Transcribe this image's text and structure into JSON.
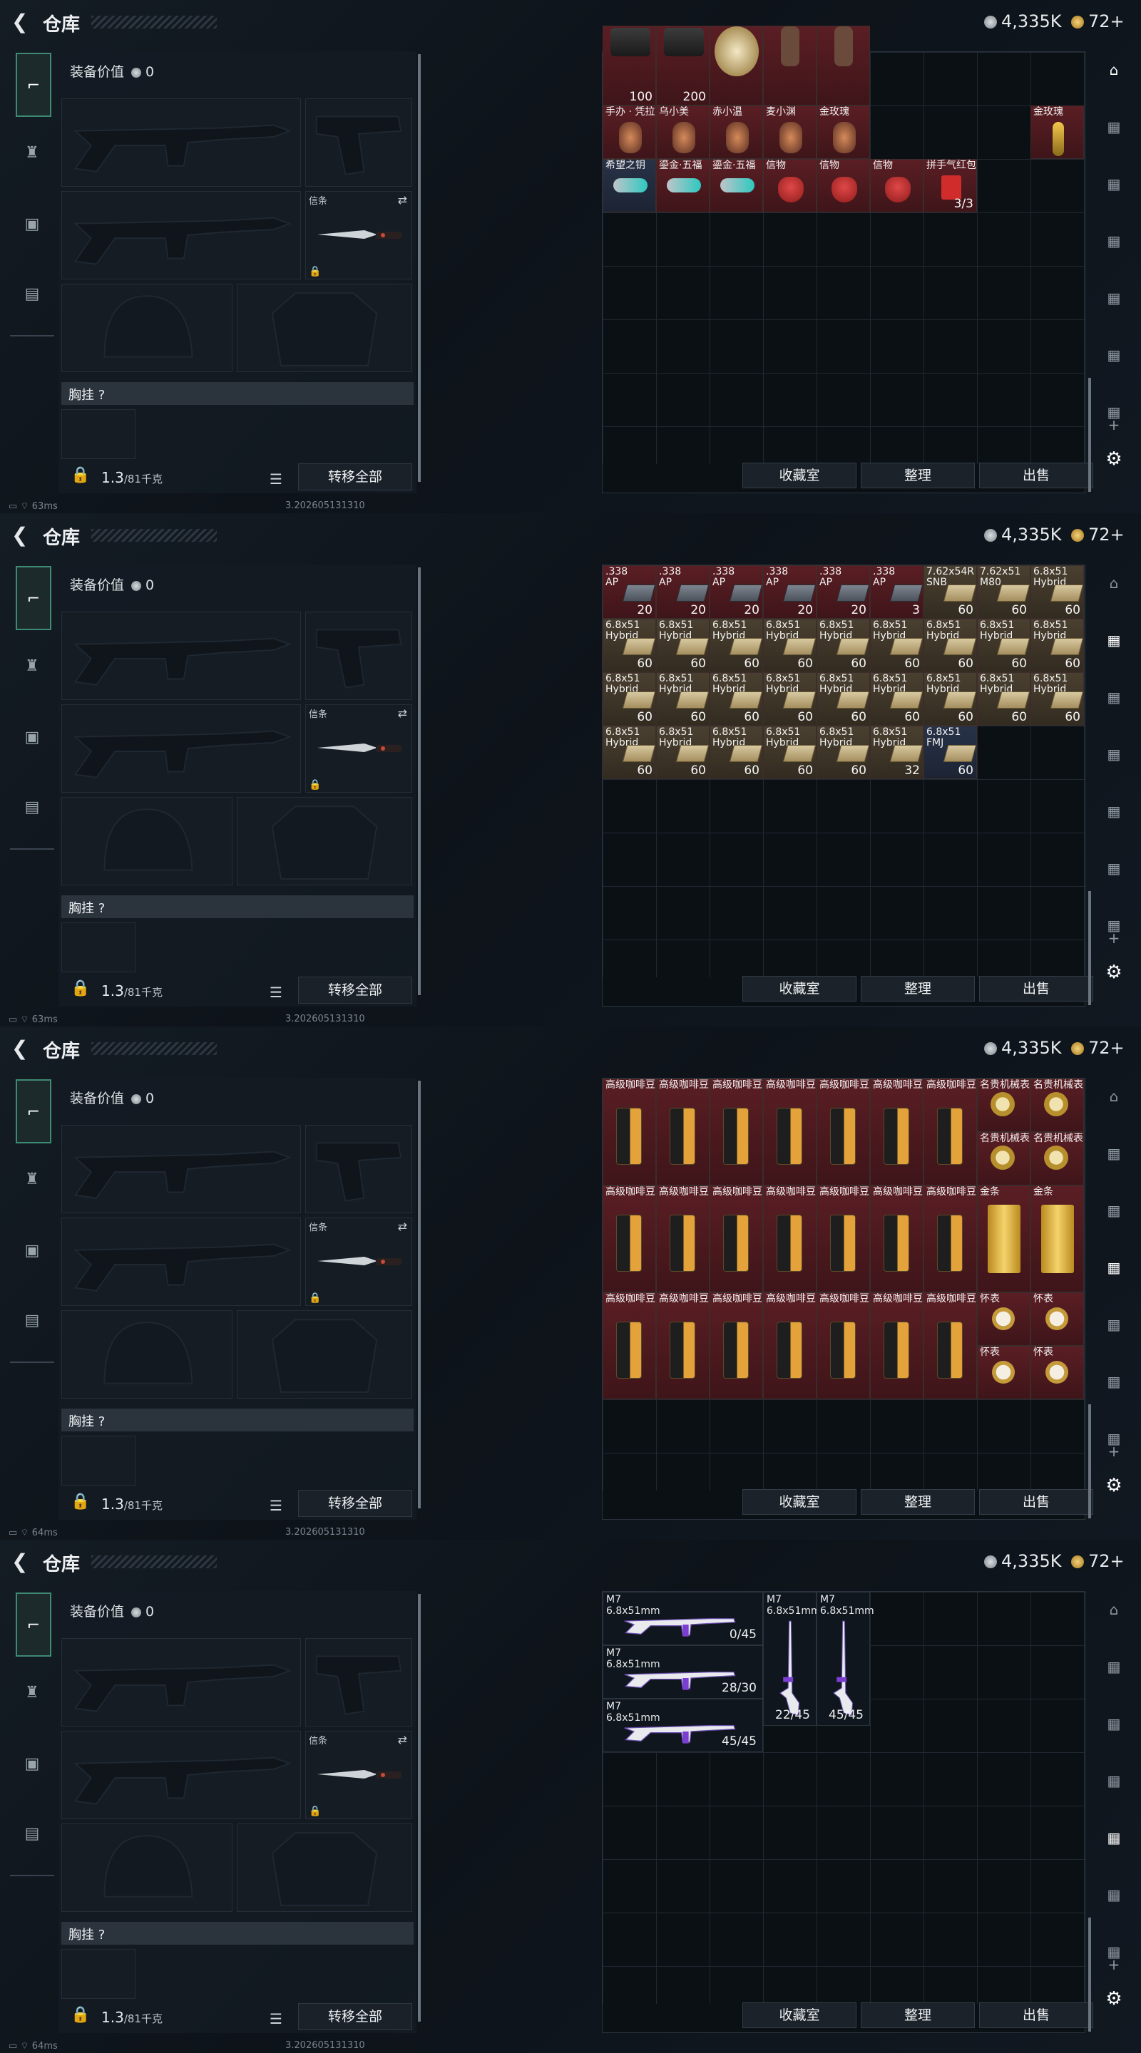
{
  "header": {
    "title": "仓库",
    "currency1": "4,335K",
    "currency2": "72+"
  },
  "equipment": {
    "value_label": "装备价值",
    "value": "0",
    "knife_label": "信条",
    "chest_label": "胸挂 ?",
    "weight": "1.3",
    "weight_max": "/81千克",
    "transfer_label": "转移全部"
  },
  "stash_buttons": {
    "collection": "收藏室",
    "sort": "整理",
    "sell": "出售"
  },
  "status": {
    "ping1": "63ms",
    "ping2": "63ms",
    "ping3": "64ms",
    "ping4": "64ms",
    "build": "3.202605131310"
  },
  "panel1": {
    "row0": [
      {
        "count": "100"
      },
      {
        "count": "200"
      }
    ],
    "row1": [
      "手办 · 凭拉",
      "乌小美",
      "赤小温",
      "麦小渊",
      "金玫瑰"
    ],
    "row2": [
      "希望之钥",
      "鎏金·五福",
      "鎏金·五福",
      "信物",
      "信物",
      "信物",
      "拼手气红包"
    ],
    "red_envelope_count": "3/3"
  },
  "panel2": {
    "row0": [
      {
        "n1": ".338",
        "n2": "AP",
        "c": "20"
      },
      {
        "n1": ".338",
        "n2": "AP",
        "c": "20"
      },
      {
        "n1": ".338",
        "n2": "AP",
        "c": "20"
      },
      {
        "n1": ".338",
        "n2": "AP",
        "c": "20"
      },
      {
        "n1": ".338",
        "n2": "AP",
        "c": "20"
      },
      {
        "n1": ".338",
        "n2": "AP",
        "c": "3"
      },
      {
        "n1": "7.62x54R",
        "n2": "SNB",
        "c": "60"
      },
      {
        "n1": "7.62x51",
        "n2": "M80",
        "c": "60"
      },
      {
        "n1": "6.8x51",
        "n2": "Hybrid",
        "c": "60"
      }
    ],
    "hybrid_name": "6.8x51",
    "hybrid_sub": "Hybrid",
    "fmj_name": "6.8x51",
    "fmj_sub": "FMJ",
    "std_count": "60",
    "partial_count": "32"
  },
  "panel3": {
    "coffee": "高级咖啡豆",
    "watch": "名贵机械表",
    "gold": "金条",
    "pocket": "怀表"
  },
  "panel4": {
    "gun_name": "M7",
    "gun_caliber": "6.8x51mm",
    "guns": [
      {
        "count": "0/45"
      },
      {
        "count": "28/30"
      },
      {
        "count": "45/45"
      },
      {
        "count": "22/45"
      },
      {
        "count": "45/45"
      }
    ]
  },
  "icons": {
    "back": "back-arrow-icon",
    "coin": "coin-icon",
    "gold_coin": "gold-coin-icon",
    "lock": "lock-icon",
    "swap": "swap-icon",
    "gear": "gear-icon",
    "plus": "plus-icon",
    "list": "list-icon"
  },
  "colors": {
    "accent": "#3e8a74",
    "red_cell": "#5a1e24",
    "stash_bg": "#0b1015"
  }
}
